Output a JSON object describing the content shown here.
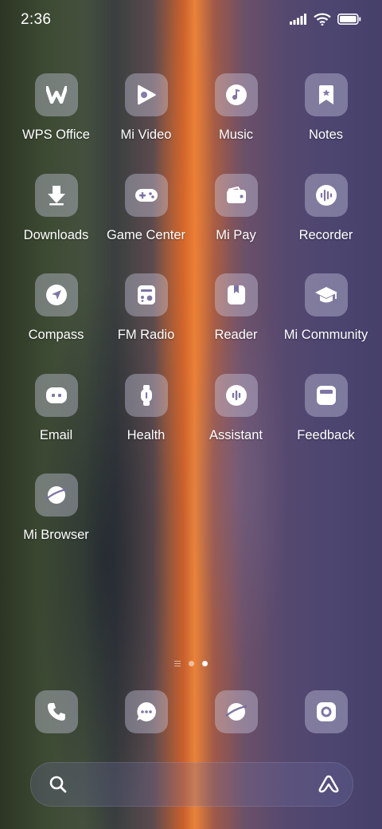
{
  "status_bar": {
    "time": "2:36",
    "icons": [
      "cellular-signal-icon",
      "wifi-icon",
      "battery-icon"
    ]
  },
  "apps": [
    {
      "label": "WPS Office",
      "icon": "wps-office-icon"
    },
    {
      "label": "Mi Video",
      "icon": "play-icon"
    },
    {
      "label": "Music",
      "icon": "music-note-icon"
    },
    {
      "label": "Notes",
      "icon": "bookmark-icon"
    },
    {
      "label": "Downloads",
      "icon": "download-arrow-icon"
    },
    {
      "label": "Game Center",
      "icon": "gamepad-icon"
    },
    {
      "label": "Mi Pay",
      "icon": "wallet-icon"
    },
    {
      "label": "Recorder",
      "icon": "waveform-icon"
    },
    {
      "label": "Compass",
      "icon": "compass-arrow-icon"
    },
    {
      "label": "FM Radio",
      "icon": "radio-icon"
    },
    {
      "label": "Reader",
      "icon": "book-icon"
    },
    {
      "label": "Mi Community",
      "icon": "graduation-cap-icon"
    },
    {
      "label": "Email",
      "icon": "email-icon"
    },
    {
      "label": "Health",
      "icon": "smartwatch-icon"
    },
    {
      "label": "Assistant",
      "icon": "assistant-icon"
    },
    {
      "label": "Feedback",
      "icon": "feedback-icon"
    },
    {
      "label": "Mi Browser",
      "icon": "planet-icon"
    }
  ],
  "pages": {
    "count": 2,
    "active": 2
  },
  "dock": [
    {
      "icon": "phone-icon"
    },
    {
      "icon": "message-bubble-icon"
    },
    {
      "icon": "browser-planet-icon"
    },
    {
      "icon": "camera-icon"
    }
  ],
  "search_bar": {
    "left_icon": "search-icon",
    "right_icon": "assistant-a-icon"
  }
}
